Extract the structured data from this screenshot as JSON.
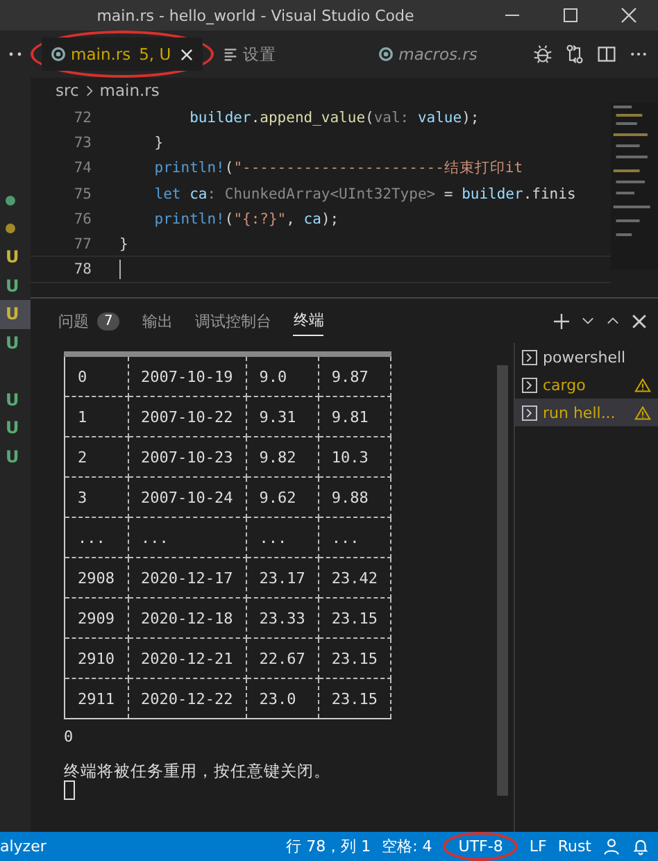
{
  "window": {
    "title": "main.rs - hello_world - Visual Studio Code"
  },
  "tabs": [
    {
      "label": "main.rs",
      "badge": "5, U",
      "selected": true,
      "kind": "rust",
      "modified": true,
      "circled": true
    },
    {
      "label": "设置",
      "selected": false,
      "kind": "settings",
      "modified": false,
      "circled": false
    },
    {
      "label": "macros.rs",
      "selected": false,
      "kind": "rust",
      "modified": false,
      "circled": false
    }
  ],
  "breadcrumb": [
    "src",
    "main.rs"
  ],
  "gutter": [
    {
      "kind": "dot",
      "color": "#4e9a6f"
    },
    {
      "kind": "dot",
      "color": "#a08a2a"
    },
    {
      "kind": "letter",
      "text": "U",
      "color": "#c8b33a",
      "selected": false
    },
    {
      "kind": "letter",
      "text": "U",
      "color": "#5aa874",
      "selected": false
    },
    {
      "kind": "letter",
      "text": "U",
      "color": "#c8b33a",
      "selected": true
    },
    {
      "kind": "letter",
      "text": "U",
      "color": "#5aa874",
      "selected": false
    },
    {
      "kind": "gap"
    },
    {
      "kind": "letter",
      "text": "U",
      "color": "#5aa874",
      "selected": false
    },
    {
      "kind": "letter",
      "text": "U",
      "color": "#5aa874",
      "selected": false
    },
    {
      "kind": "letter",
      "text": "U",
      "color": "#5aa874",
      "selected": false
    }
  ],
  "code": [
    {
      "number": "72",
      "current": false,
      "tokens": [
        {
          "kind": "var",
          "text": "        builder"
        },
        {
          "kind": "punct",
          "text": "."
        },
        {
          "kind": "fn",
          "text": "append_value"
        },
        {
          "kind": "punct",
          "text": "("
        },
        {
          "kind": "hint",
          "text": "val: "
        },
        {
          "kind": "var",
          "text": "value"
        },
        {
          "kind": "punct",
          "text": ");"
        }
      ]
    },
    {
      "number": "73",
      "current": false,
      "tokens": [
        {
          "kind": "punct",
          "text": "    }"
        }
      ]
    },
    {
      "number": "74",
      "current": false,
      "tokens": [
        {
          "kind": "macro",
          "text": "    println!"
        },
        {
          "kind": "punct",
          "text": "("
        },
        {
          "kind": "str",
          "text": "\"-----------------------结束打印it"
        }
      ]
    },
    {
      "number": "75",
      "current": false,
      "tokens": [
        {
          "kind": "keyword",
          "text": "    let "
        },
        {
          "kind": "var",
          "text": "ca"
        },
        {
          "kind": "hint",
          "text": ": ChunkedArray<UInt32Type>"
        },
        {
          "kind": "punct",
          "text": " = "
        },
        {
          "kind": "var",
          "text": "builder"
        },
        {
          "kind": "punct",
          "text": ".finis"
        }
      ]
    },
    {
      "number": "76",
      "current": false,
      "tokens": [
        {
          "kind": "macro",
          "text": "    println!"
        },
        {
          "kind": "punct",
          "text": "("
        },
        {
          "kind": "str",
          "text": "\"{:?}\""
        },
        {
          "kind": "punct",
          "text": ", "
        },
        {
          "kind": "var",
          "text": "ca"
        },
        {
          "kind": "punct",
          "text": ");"
        }
      ]
    },
    {
      "number": "77",
      "current": false,
      "tokens": [
        {
          "kind": "punct",
          "text": "}"
        }
      ]
    },
    {
      "number": "78",
      "current": true
    }
  ],
  "panel": {
    "tabs": [
      {
        "label": "问题",
        "count": "7",
        "selected": false
      },
      {
        "label": "输出",
        "selected": false
      },
      {
        "label": "调试控制台",
        "selected": false
      },
      {
        "label": "终端",
        "selected": true
      }
    ],
    "terminal_table": [
      [
        "0",
        "2007-10-19",
        "9.0",
        "9.87"
      ],
      [
        "1",
        "2007-10-22",
        "9.31",
        "9.81"
      ],
      [
        "2",
        "2007-10-23",
        "9.82",
        "10.3"
      ],
      [
        "3",
        "2007-10-24",
        "9.62",
        "9.88"
      ],
      [
        "...",
        "...",
        "...",
        "..."
      ],
      [
        "2908",
        "2020-12-17",
        "23.17",
        "23.42"
      ],
      [
        "2909",
        "2020-12-18",
        "23.33",
        "23.15"
      ],
      [
        "2910",
        "2020-12-21",
        "22.67",
        "23.15"
      ],
      [
        "2911",
        "2020-12-22",
        "23.0",
        "23.15"
      ]
    ],
    "output": [
      "0",
      "终端将被任务重用，按任意键关闭。"
    ],
    "terminals": [
      {
        "name": "powershell",
        "warning": false,
        "selected": false
      },
      {
        "name": "cargo",
        "warning": true,
        "selected": false
      },
      {
        "name": "run hell...",
        "warning": true,
        "selected": true
      }
    ]
  },
  "status_bar": {
    "left": "alyzer",
    "items": [
      {
        "text": "行 78，列 1",
        "circled": false
      },
      {
        "text": "空格: 4",
        "circled": false
      },
      {
        "text": "UTF-8",
        "circled": true
      },
      {
        "text": "LF",
        "circled": false
      },
      {
        "text": "Rust",
        "circled": false
      }
    ]
  }
}
